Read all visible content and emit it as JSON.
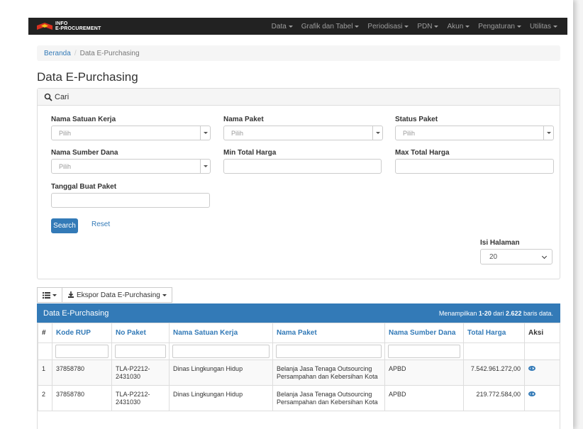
{
  "brand": {
    "line1": "INFO",
    "line2": "E-PROCUREMENT"
  },
  "nav": [
    "Data",
    "Grafik dan Tabel",
    "Periodisasi",
    "PDN",
    "Akun",
    "Pengaturan",
    "Utilitas"
  ],
  "breadcrumb": {
    "home": "Beranda",
    "current": "Data E-Purchasing"
  },
  "page_title": "Data E-Purchasing",
  "search": {
    "header": "Cari",
    "fields": {
      "satuan_kerja": {
        "label": "Nama Satuan Kerja",
        "placeholder": "Pilih"
      },
      "nama_paket": {
        "label": "Nama Paket",
        "placeholder": "Pilih"
      },
      "status_paket": {
        "label": "Status Paket",
        "placeholder": "Pilih"
      },
      "sumber_dana": {
        "label": "Nama Sumber Dana",
        "placeholder": "Pilih"
      },
      "min_harga": {
        "label": "Min Total Harga"
      },
      "max_harga": {
        "label": "Max Total Harga"
      },
      "tanggal": {
        "label": "Tanggal Buat Paket"
      }
    },
    "search_button": "Search",
    "reset_link": "Reset",
    "page_size_label": "Isi Halaman",
    "page_size_value": "20"
  },
  "toolbar": {
    "export_label": "Ekspor Data E-Purchasing"
  },
  "grid": {
    "title": "Data E-Purchasing",
    "info_prefix": "Menampilkan ",
    "info_range": "1-20",
    "info_mid": " dari ",
    "info_total": "2.622",
    "info_suffix": " baris data.",
    "columns": [
      "#",
      "Kode RUP",
      "No Paket",
      "Nama Satuan Kerja",
      "Nama Paket",
      "Nama Sumber Dana",
      "Total Harga",
      "Aksi"
    ],
    "rows": [
      {
        "no": "1",
        "kode": "37858780",
        "paket_no": "TLA-P2212-2431030",
        "satker": "Dinas Lingkungan Hidup",
        "nama": "Belanja Jasa Tenaga Outsourcing Persampahan dan Kebersihan Kota",
        "dana": "APBD",
        "harga": "7.542.961.272,00"
      },
      {
        "no": "2",
        "kode": "37858780",
        "paket_no": "TLA-P2212-2431030",
        "satker": "Dinas Lingkungan Hidup",
        "nama": "Belanja Jasa Tenaga Outsourcing Persampahan dan Kebersihan Kota",
        "dana": "APBD",
        "harga": "219.772.584,00"
      }
    ]
  }
}
